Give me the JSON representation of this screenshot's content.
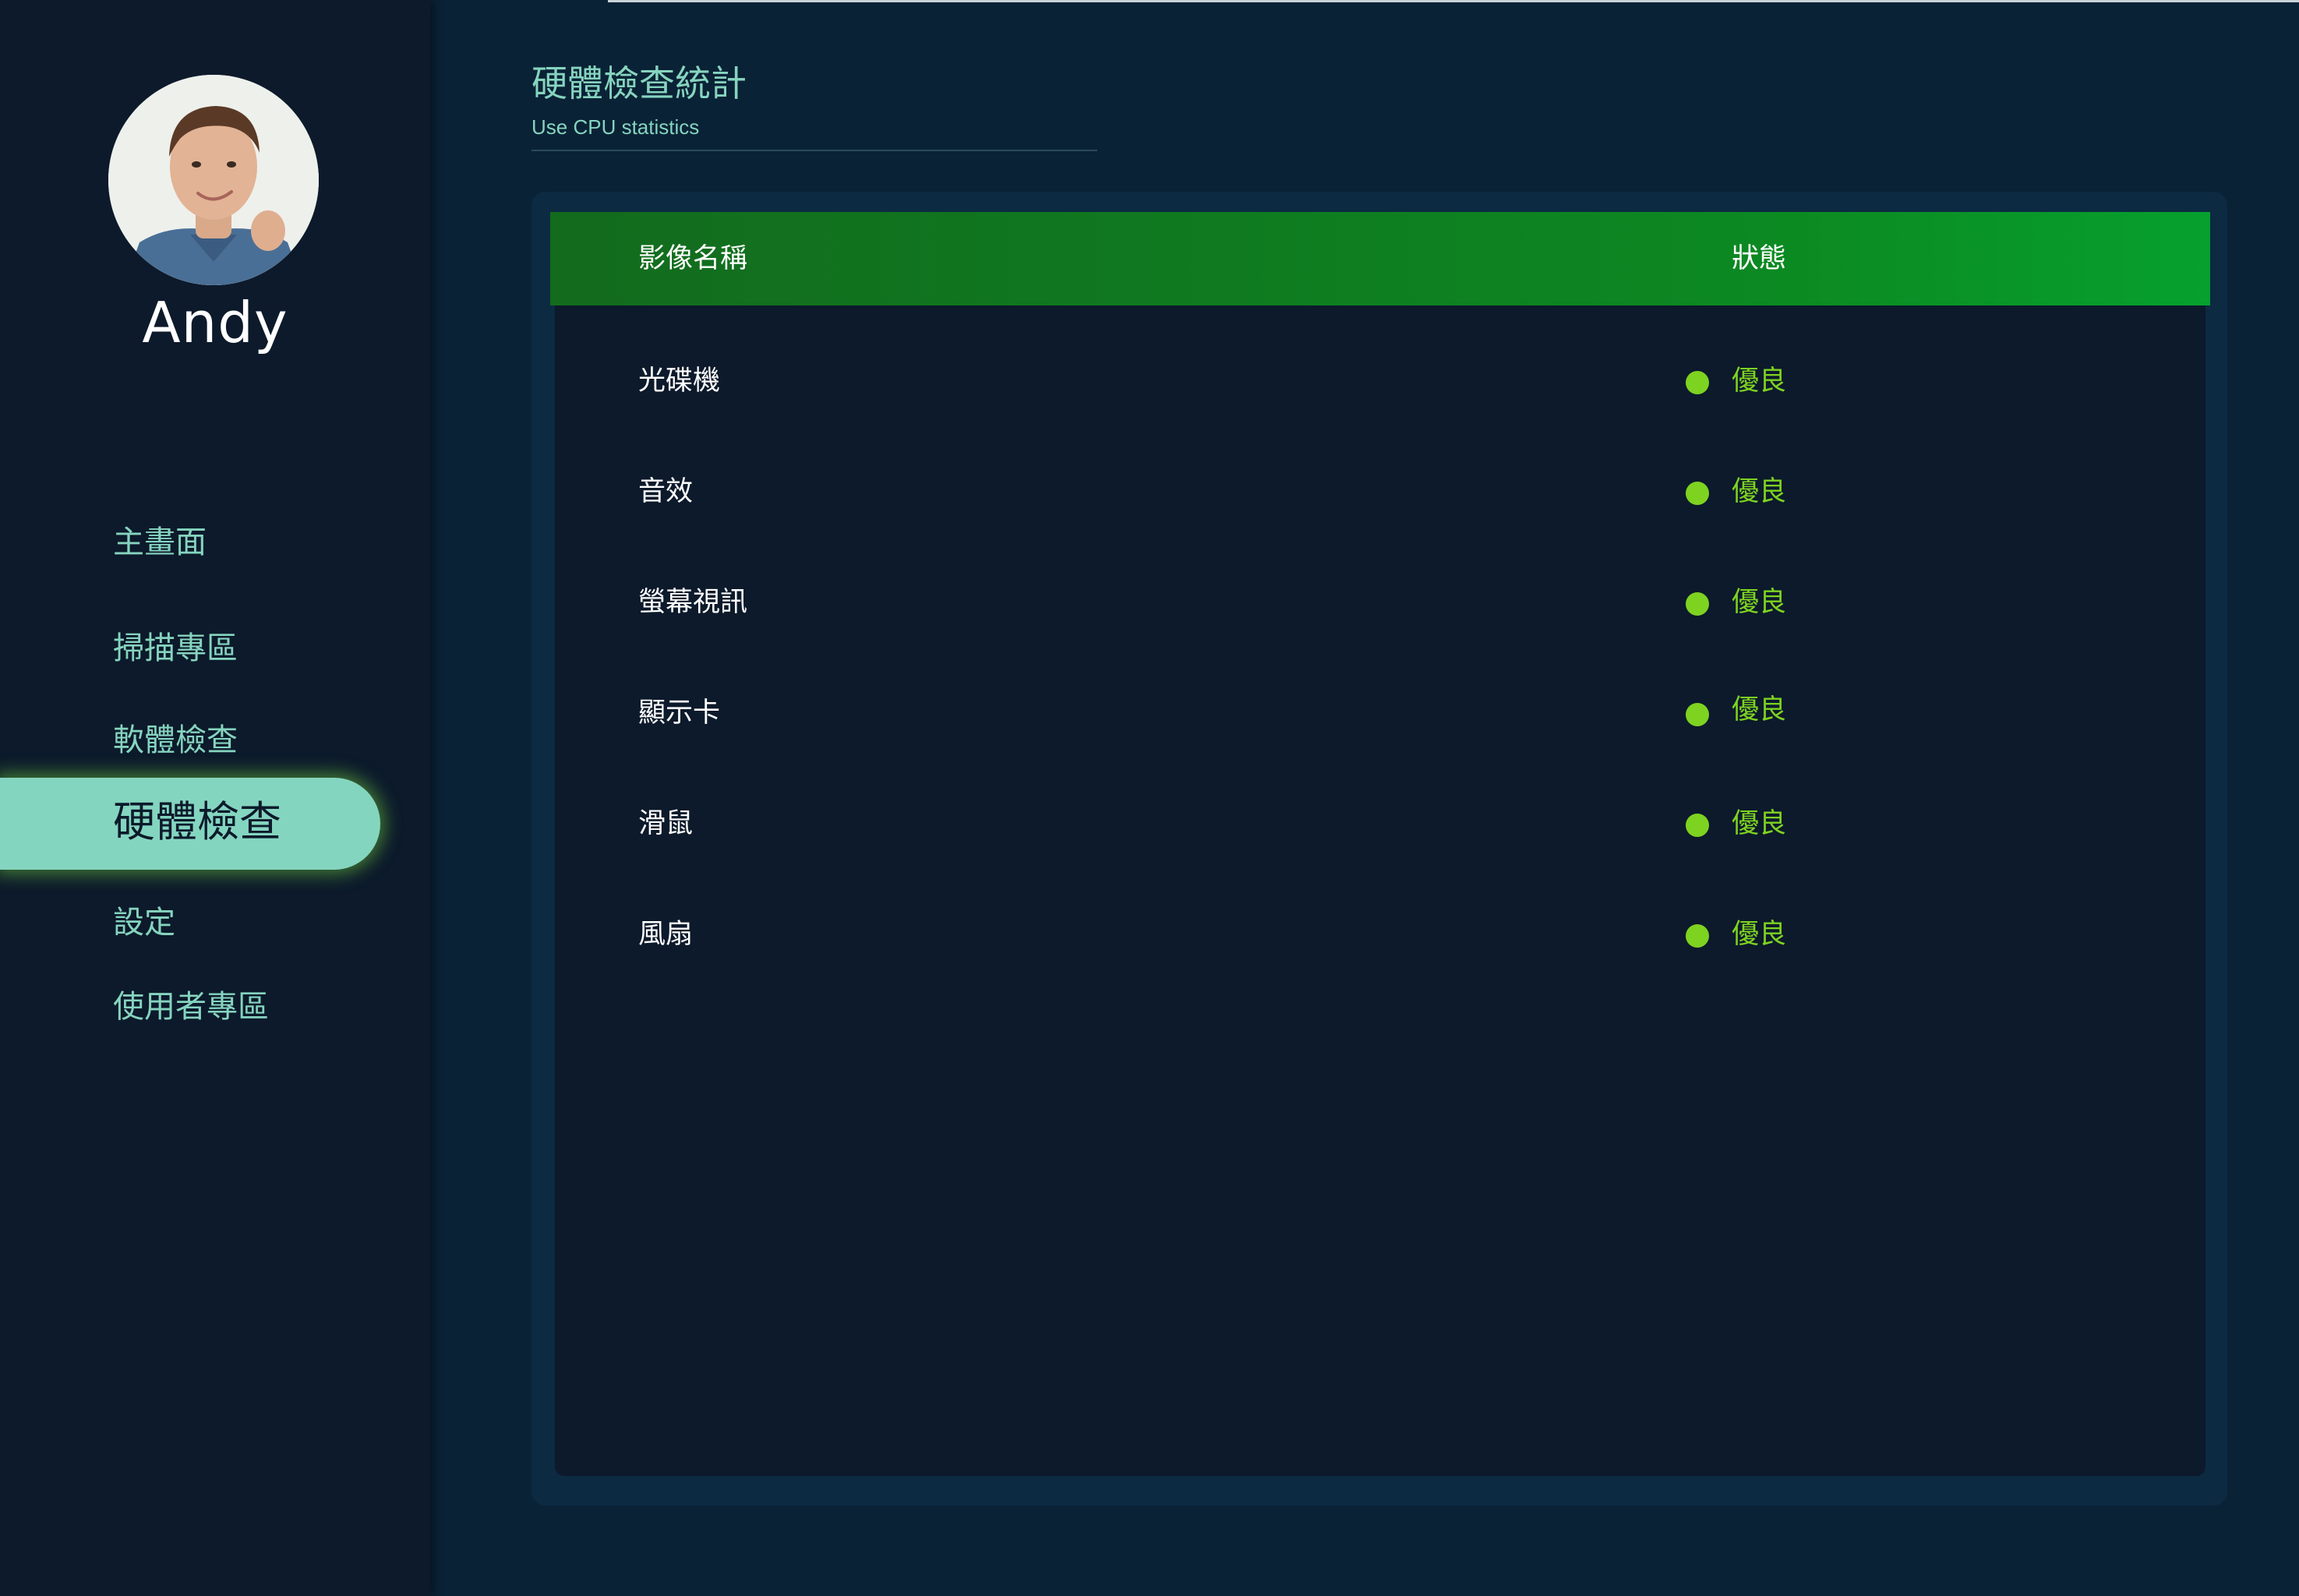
{
  "user": {
    "name": "Andy"
  },
  "nav": {
    "items": [
      {
        "label": "主畫面"
      },
      {
        "label": "掃描專區"
      },
      {
        "label": "軟體檢查"
      },
      {
        "label": "硬體檢查",
        "active": true
      },
      {
        "label": "設定"
      },
      {
        "label": "使用者專區"
      }
    ]
  },
  "header": {
    "title": "硬體檢查統計",
    "subtitle": "Use CPU statistics"
  },
  "table": {
    "columns": [
      "影像名稱",
      "狀態"
    ],
    "rows": [
      {
        "name": "光碟機",
        "status": "優良"
      },
      {
        "name": "音效",
        "status": "優良"
      },
      {
        "name": "螢幕視訊",
        "status": "優良"
      },
      {
        "name": "顯示卡",
        "status": "優良"
      },
      {
        "name": "滑鼠",
        "status": "優良"
      },
      {
        "name": "風扇",
        "status": "優良"
      }
    ]
  },
  "colors": {
    "accent": "#84d5bf",
    "status_good": "#7ed321",
    "header_gradient_start": "#136b1d",
    "header_gradient_end": "#06a02e",
    "sidebar_bg": "#0c1a2b",
    "main_bg": "#0a2236"
  }
}
